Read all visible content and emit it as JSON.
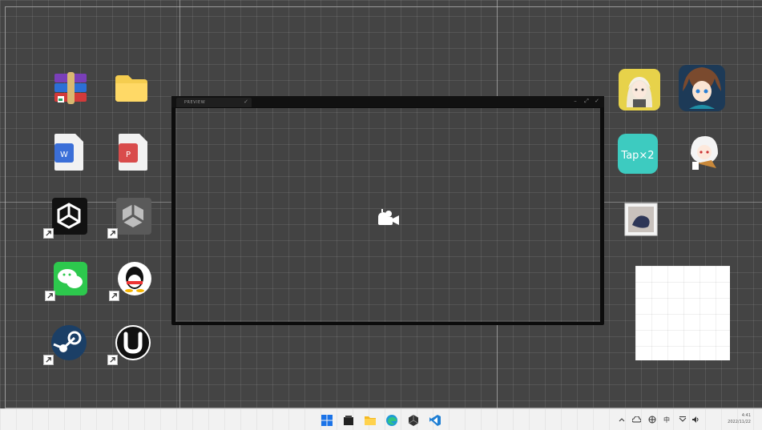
{
  "desktop": {
    "left_icons": [
      {
        "name": "winrar-icon"
      },
      {
        "name": "folder-icon"
      },
      {
        "name": "word-document-icon"
      },
      {
        "name": "wps-pdf-icon"
      },
      {
        "name": "unity-hub-icon",
        "shortcut": true
      },
      {
        "name": "unity-editor-icon",
        "shortcut": true
      },
      {
        "name": "wechat-icon",
        "shortcut": true
      },
      {
        "name": "qq-icon",
        "shortcut": true
      },
      {
        "name": "steam-icon",
        "shortcut": true
      },
      {
        "name": "unreal-engine-icon",
        "shortcut": true
      }
    ],
    "right_icons": [
      {
        "name": "anime-character-app-icon"
      },
      {
        "name": "arknights-character-app-icon"
      },
      {
        "name": "taptap-icon",
        "label": "Tap×2"
      },
      {
        "name": "chibi-character-app-icon"
      },
      {
        "name": "photo-shortcut-icon"
      }
    ]
  },
  "window": {
    "tab_title": "PREVIEW",
    "center_icon": "camera-icon"
  },
  "taskbar": {
    "apps": [
      "start-icon",
      "file-explorer-icon",
      "folder-icon",
      "edge-icon",
      "unity-icon",
      "vscode-icon"
    ],
    "tray": [
      "chevron-up-icon",
      "cloud-icon",
      "network-icon",
      "input-method-icon",
      "language-icon",
      "speaker-icon"
    ],
    "clock": {
      "time": "4:41",
      "date": "2022/11/22"
    }
  },
  "colors": {
    "desktop_bg": "#444444",
    "taskbar_bg": "#f2f2f2",
    "window_frame": "#0c0c0c"
  }
}
